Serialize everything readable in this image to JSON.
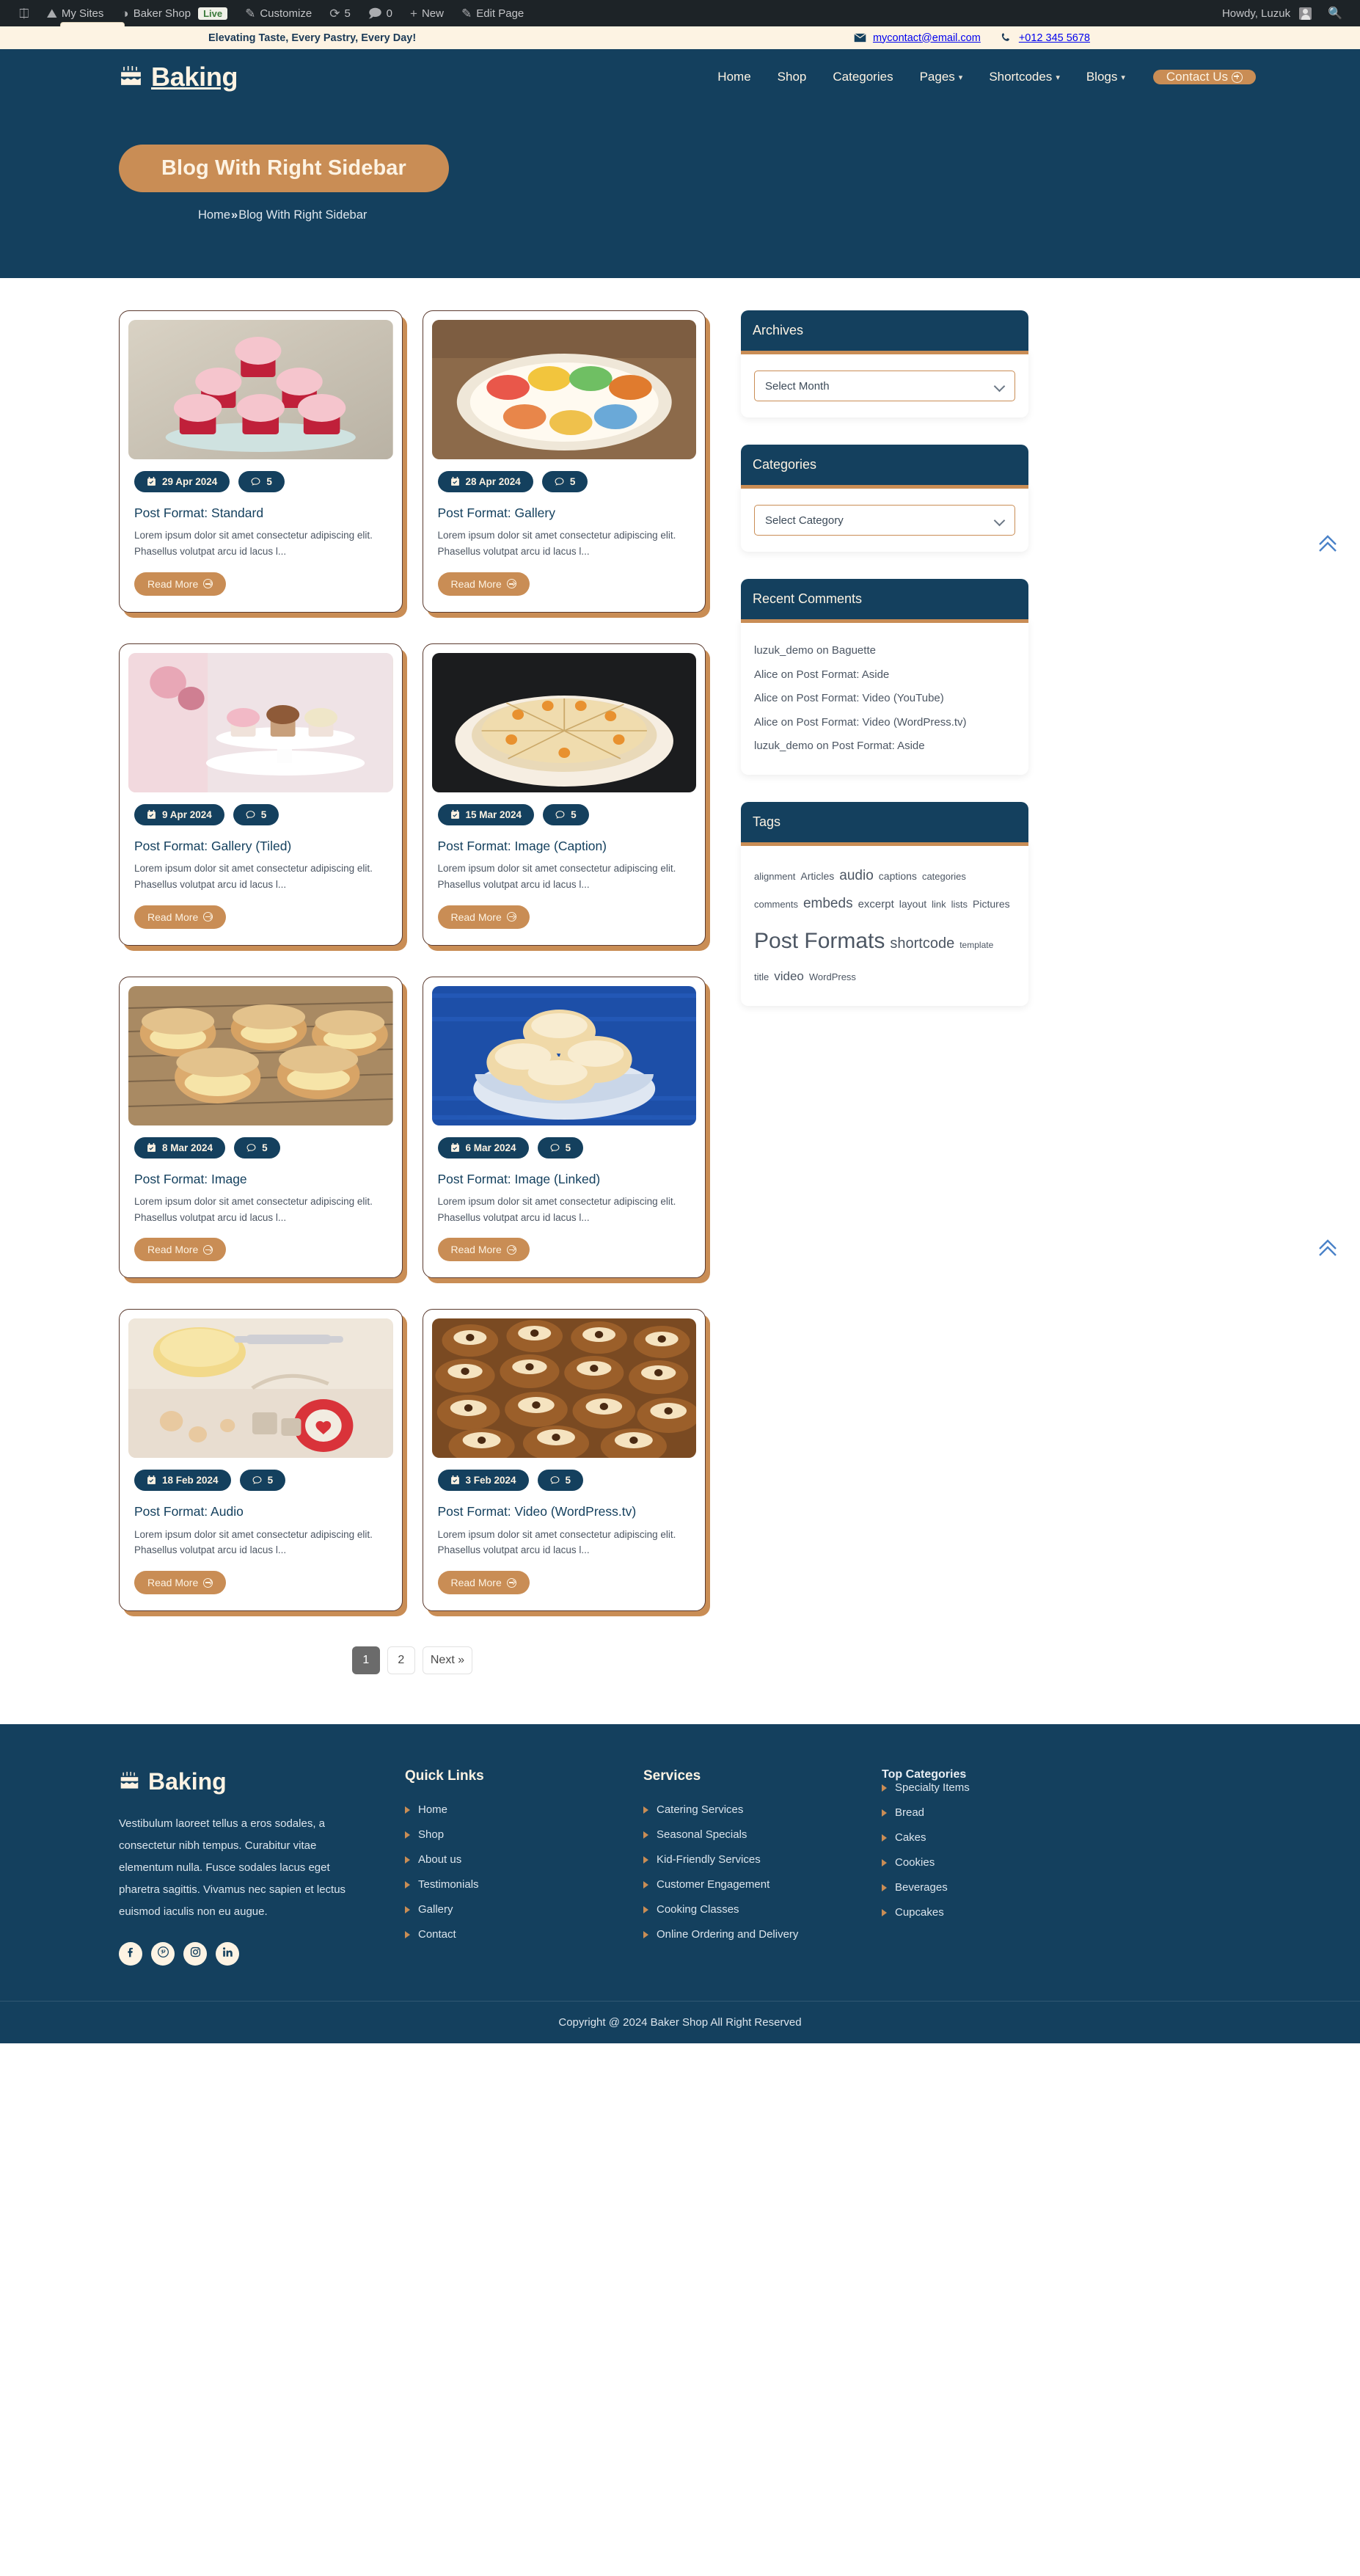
{
  "adminbar": {
    "items": [
      {
        "icon": "wordpress-logo-icon",
        "label": ""
      },
      {
        "icon": "my-sites-icon",
        "label": "My Sites"
      },
      {
        "icon": "dashboard-icon",
        "label": "Baker Shop"
      },
      {
        "icon": "live-badge",
        "label": "Live"
      },
      {
        "icon": "customize-icon",
        "label": "Customize"
      },
      {
        "icon": "updates-icon",
        "label": "5"
      },
      {
        "icon": "comments-icon",
        "label": "0"
      },
      {
        "icon": "new-icon",
        "label": "New"
      },
      {
        "icon": "edit-icon",
        "label": "Edit Page"
      }
    ],
    "howdy": "Howdy, Luzuk",
    "search_icon": "search-icon"
  },
  "topbar": {
    "tagline": "Elevating Taste, Every Pastry, Every Day!",
    "email": "mycontact@email.com",
    "phone": "+012 345 5678",
    "email_icon": "envelope-icon",
    "phone_icon": "phone-icon"
  },
  "header": {
    "brand": "Baking",
    "brand_icon": "cake-icon",
    "nav": [
      {
        "label": "Home",
        "has_caret": false
      },
      {
        "label": "Shop",
        "has_caret": false
      },
      {
        "label": "Categories",
        "has_caret": false
      },
      {
        "label": "Pages",
        "has_caret": true
      },
      {
        "label": "Shortcodes",
        "has_caret": true
      },
      {
        "label": "Blogs",
        "has_caret": true
      }
    ],
    "cta_label": "Contact Us"
  },
  "hero": {
    "title": "Blog With Right Sidebar",
    "breadcrumb_home": "Home",
    "breadcrumb_sep": "»",
    "breadcrumb_current": "Blog With Right Sidebar"
  },
  "posts": [
    {
      "title": "Post Format: Standard",
      "date": "29 Apr 2024",
      "comments": "5",
      "excerpt": "Lorem ipsum dolor sit amet consectetur adipiscing elit. Phasellus volutpat arcu id lacus l...",
      "read_more": "Read More",
      "image_alt": "pink-cupcakes-on-glass-stand"
    },
    {
      "title": "Post Format: Gallery",
      "date": "28 Apr 2024",
      "comments": "5",
      "excerpt": "Lorem ipsum dolor sit amet consectetur adipiscing elit. Phasellus volutpat arcu id lacus l...",
      "read_more": "Read More",
      "image_alt": "colorful-macarons-in-bowl"
    },
    {
      "title": "Post Format: Gallery (Tiled)",
      "date": "9 Apr 2024",
      "comments": "5",
      "excerpt": "Lorem ipsum dolor sit amet consectetur adipiscing elit. Phasellus volutpat arcu id lacus l...",
      "read_more": "Read More",
      "image_alt": "cupcakes-on-white-cake-stand"
    },
    {
      "title": "Post Format: Image (Caption)",
      "date": "15 Mar 2024",
      "comments": "5",
      "excerpt": "Lorem ipsum dolor sit amet consectetur adipiscing elit. Phasellus volutpat arcu id lacus l...",
      "read_more": "Read More",
      "image_alt": "orange-glazed-cake-sliced"
    },
    {
      "title": "Post Format: Image",
      "date": "8 Mar 2024",
      "comments": "5",
      "excerpt": "Lorem ipsum dolor sit amet consectetur adipiscing elit. Phasellus volutpat arcu id lacus l...",
      "read_more": "Read More",
      "image_alt": "cream-puffs-on-cooling-rack"
    },
    {
      "title": "Post Format: Image (Linked)",
      "date": "6 Mar 2024",
      "comments": "5",
      "excerpt": "Lorem ipsum dolor sit amet consectetur adipiscing elit. Phasellus volutpat arcu id lacus l...",
      "read_more": "Read More",
      "image_alt": "sugared-buns-in-bowl-blue-cloth"
    },
    {
      "title": "Post Format: Audio",
      "date": "18 Feb 2024",
      "comments": "5",
      "excerpt": "Lorem ipsum dolor sit amet consectetur adipiscing elit. Phasellus volutpat arcu id lacus l...",
      "read_more": "Read More",
      "image_alt": "baking-prep-rolling-pin-flatlay"
    },
    {
      "title": "Post Format: Video (WordPress.tv)",
      "date": "3 Feb 2024",
      "comments": "5",
      "excerpt": "Lorem ipsum dolor sit amet consectetur adipiscing elit. Phasellus volutpat arcu id lacus l...",
      "read_more": "Read More",
      "image_alt": "chocolate-chip-cookies-tray"
    }
  ],
  "pagination": {
    "pages": [
      "1",
      "2"
    ],
    "current": "1",
    "next_label": "Next »"
  },
  "sidebar": {
    "archives": {
      "title": "Archives",
      "select_value": "Select Month"
    },
    "categories": {
      "title": "Categories",
      "select_value": "Select Category"
    },
    "recent_comments": {
      "title": "Recent Comments",
      "items": [
        "luzuk_demo on Baguette",
        "Alice on Post Format: Aside",
        "Alice on Post Format: Video (YouTube)",
        "Alice on Post Format: Video (WordPress.tv)",
        "luzuk_demo on Post Format: Aside"
      ]
    },
    "tags": {
      "title": "Tags",
      "items": [
        {
          "label": "alignment",
          "size": 13
        },
        {
          "label": "Articles",
          "size": 14
        },
        {
          "label": "audio",
          "size": 19
        },
        {
          "label": "captions",
          "size": 14
        },
        {
          "label": "categories",
          "size": 13
        },
        {
          "label": "comments",
          "size": 13
        },
        {
          "label": "embeds",
          "size": 19
        },
        {
          "label": "excerpt",
          "size": 15
        },
        {
          "label": "layout",
          "size": 14
        },
        {
          "label": "link",
          "size": 13
        },
        {
          "label": "lists",
          "size": 13
        },
        {
          "label": "Pictures",
          "size": 14
        },
        {
          "label": "Post Formats",
          "size": 30
        },
        {
          "label": "shortcode",
          "size": 20
        },
        {
          "label": "template",
          "size": 12
        },
        {
          "label": "title",
          "size": 13
        },
        {
          "label": "video",
          "size": 17
        },
        {
          "label": "WordPress",
          "size": 13
        }
      ]
    }
  },
  "footer": {
    "brand": "Baking",
    "about": "Vestibulum laoreet tellus a eros sodales, a consectetur nibh tempus. Curabitur vitae elementum nulla. Fusce sodales lacus eget pharetra sagittis. Vivamus nec sapien et lectus euismod iaculis non eu augue.",
    "socials": [
      "facebook-icon",
      "pinterest-icon",
      "instagram-icon",
      "linkedin-icon"
    ],
    "columns": [
      {
        "title": "Quick Links",
        "links": [
          "Home",
          "Shop",
          "About us",
          "Testimonials",
          "Gallery",
          "Contact"
        ]
      },
      {
        "title": "Services",
        "links": [
          "Catering Services",
          "Seasonal Specials",
          "Kid-Friendly Services",
          "Customer Engagement",
          "Cooking Classes",
          "Online Ordering and Delivery"
        ]
      },
      {
        "title": "Top Categories",
        "links": [
          "Specialty Items",
          "Bread",
          "Cakes",
          "Cookies",
          "Beverages",
          "Cupcakes"
        ]
      }
    ],
    "copyright": "Copyright @ 2024 Baker Shop All Right Reserved"
  },
  "colors": {
    "navy": "#14405e",
    "tan": "#c98d55",
    "cream": "#fdf3e3",
    "arrow_blue": "#4a82c8"
  }
}
